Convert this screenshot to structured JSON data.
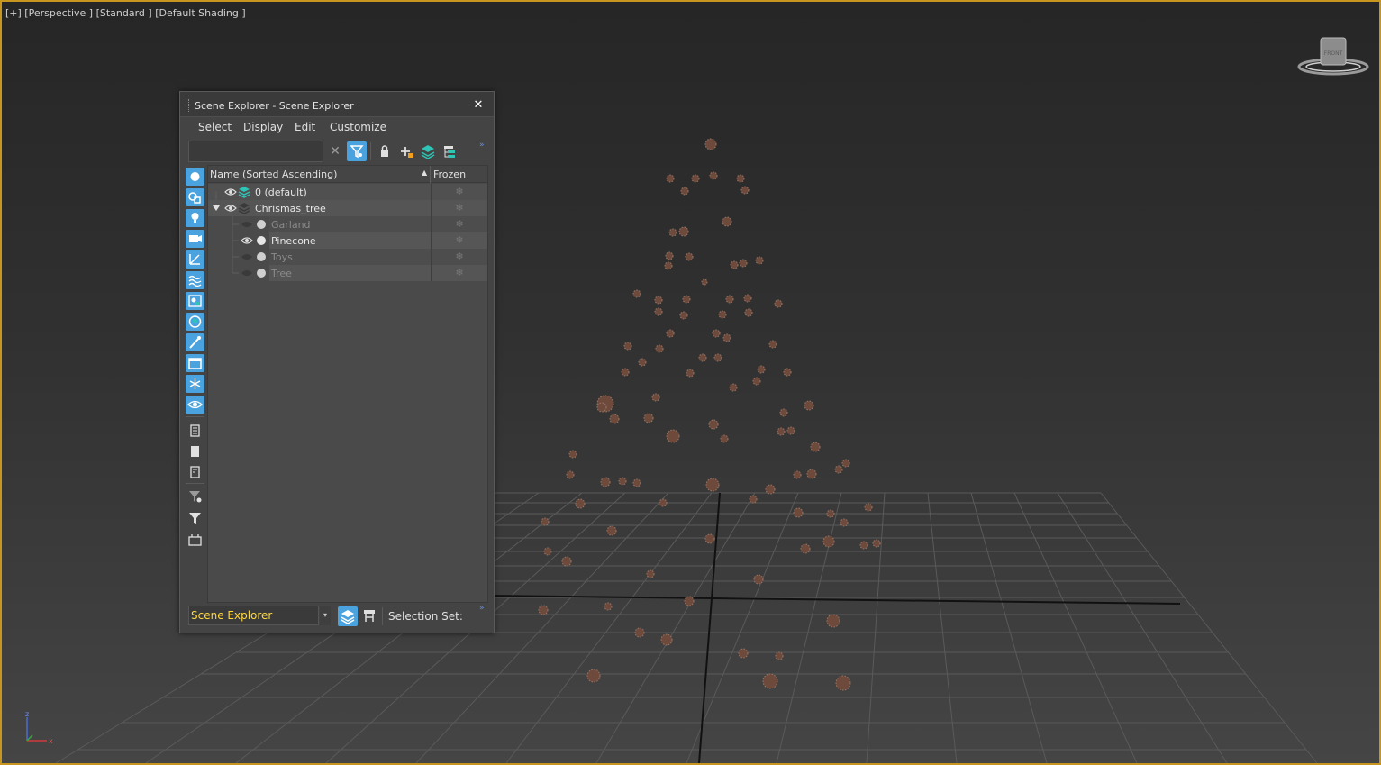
{
  "viewport": {
    "label": "[+] [Perspective ] [Standard ] [Default Shading ]",
    "viewcube_face": "FRONT",
    "axis_labels": {
      "x": "x",
      "y": "y",
      "z": "z"
    },
    "border_color": "#c8961e"
  },
  "scene_explorer": {
    "title": "Scene Explorer - Scene Explorer",
    "close_glyph": "✕",
    "menus": [
      "Select",
      "Display",
      "Edit",
      "Customize"
    ],
    "search": {
      "value": "",
      "placeholder": ""
    },
    "clear_glyph": "✕",
    "more_glyph": "»",
    "columns": {
      "name": "Name (Sorted Ascending)",
      "sort_glyph": "▲",
      "frozen": "Frozen"
    },
    "rows": [
      {
        "name": "0 (default)",
        "visible": true,
        "type": "layer-default",
        "frozen_glyph": "❄"
      },
      {
        "name": "Chrismas_tree",
        "visible": true,
        "type": "layer",
        "expanded": true,
        "frozen_glyph": "❄"
      },
      {
        "name": "Garland",
        "visible": false,
        "type": "object",
        "frozen_glyph": "❄"
      },
      {
        "name": "Pinecone",
        "visible": true,
        "type": "object",
        "frozen_glyph": "❄"
      },
      {
        "name": "Toys",
        "visible": false,
        "type": "object",
        "frozen_glyph": "❄"
      },
      {
        "name": "Tree",
        "visible": false,
        "type": "object",
        "frozen_glyph": "❄"
      }
    ],
    "bottom": {
      "explorer_select": "Scene Explorer",
      "dropdown_glyph": "▾",
      "selection_set_label": "Selection Set:"
    },
    "colors": {
      "accent": "#4aa3df",
      "highlight_text": "#ffd83a",
      "layer_icon": "#2ec4b6"
    },
    "left_toolbar_icons": [
      "display-geometry-icon",
      "display-shapes-icon",
      "display-lights-icon",
      "display-cameras-icon",
      "display-helpers-icon",
      "display-spacewarps-icon",
      "display-groups-icon",
      "display-xrefs-icon",
      "display-bones-icon",
      "display-containers-icon",
      "display-frozen-icon",
      "display-hidden-icon",
      "display-all-icon",
      "display-none-icon",
      "invert-display-icon",
      "filter-selection-icon",
      "filter-icon",
      "filter-options-icon"
    ]
  }
}
